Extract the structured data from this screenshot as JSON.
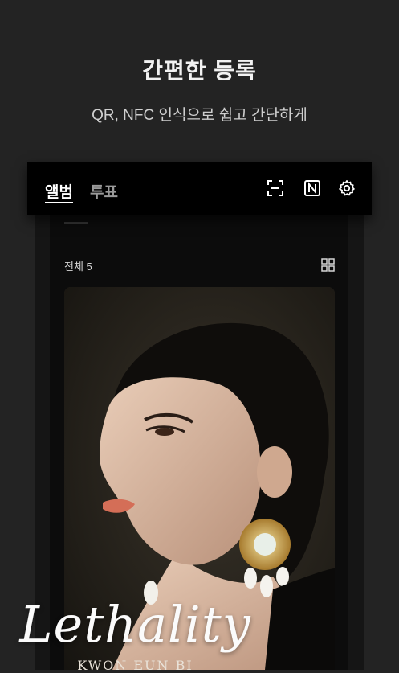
{
  "promo": {
    "headline": "간편한 등록",
    "subline": "QR, NFC 인식으로 쉽고 간단하게"
  },
  "app": {
    "tabs": [
      {
        "label": "앨범",
        "active": true
      },
      {
        "label": "투표",
        "active": false
      }
    ],
    "header_icons": [
      "qr-scan-icon",
      "nfc-icon",
      "gear-icon"
    ],
    "count_label": "전체 5",
    "view_toggle_icon": "grid-view-icon",
    "album": {
      "title": "Lethality",
      "artist": "KWON EUN BI"
    }
  },
  "colors": {
    "background": "#232323",
    "header": "#000000",
    "text": "#ffffff",
    "inactive_tab": "#9a9a9a"
  }
}
